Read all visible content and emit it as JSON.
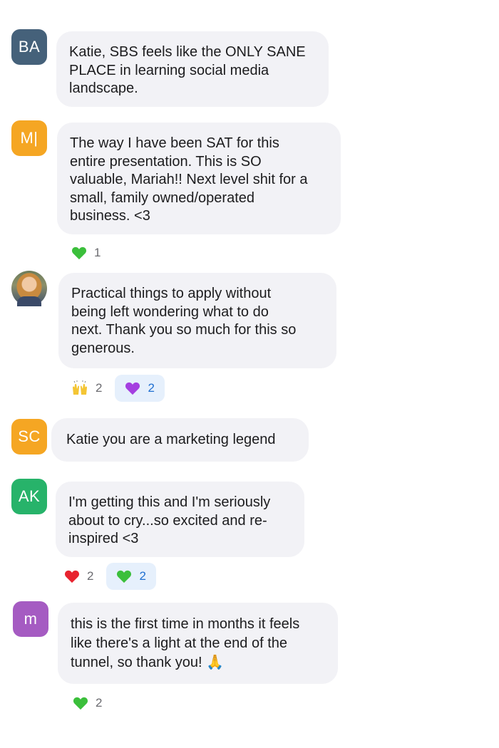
{
  "chat": {
    "messages": [
      {
        "initials": "BA",
        "avatar_color": "#45617a",
        "text": "Katie, SBS feels like the ONLY SANE\nPLACE in learning social media\nlandscape.",
        "reactions": []
      },
      {
        "initials": "M|",
        "avatar_color": "#f5a623",
        "text": "The way I have been SAT for this\nentire presentation. This is SO\nvaluable, Mariah!! Next level shit for a\nsmall, family owned/operated\nbusiness. <3",
        "reactions": [
          {
            "emoji": "green-heart-icon",
            "count": "1",
            "active": false
          }
        ]
      },
      {
        "initials": "",
        "avatar_type": "photo",
        "text": "Practical things to apply without\nbeing left wondering what to do\nnext. Thank you so much for this so\ngenerous.",
        "reactions": [
          {
            "emoji": "raising-hands-icon",
            "count": "2",
            "active": false
          },
          {
            "emoji": "purple-heart-icon",
            "count": "2",
            "active": true
          }
        ]
      },
      {
        "initials": "SC",
        "avatar_color": "#f5a623",
        "text": "Katie you are a marketing legend",
        "reactions": []
      },
      {
        "initials": "AK",
        "avatar_color": "#27b36a",
        "text": "I'm getting this and I'm seriously\nabout to cry...so excited and re-\ninspired  <3",
        "reactions": [
          {
            "emoji": "red-heart-icon",
            "count": "2",
            "active": false
          },
          {
            "emoji": "green-heart-icon",
            "count": "2",
            "active": true
          }
        ]
      },
      {
        "initials": "m",
        "avatar_color": "#a55bc2",
        "text": "this is the first time in months it feels\nlike there's a light at the end of the\ntunnel, so thank you! 🙏",
        "reactions": [
          {
            "emoji": "green-heart-icon",
            "count": "2",
            "active": false
          }
        ]
      }
    ]
  },
  "colors": {
    "bubble_bg": "#f2f2f6",
    "active_reaction_bg": "#e6f0fc",
    "active_reaction_text": "#1f6fd1"
  }
}
